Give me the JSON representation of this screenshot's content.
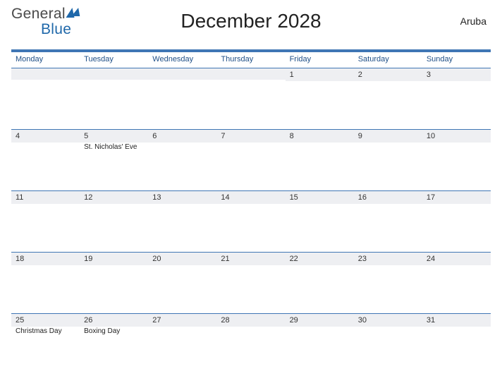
{
  "logo": {
    "part1": "General",
    "part2": "Blue"
  },
  "title": "December 2028",
  "region": "Aruba",
  "dayHeaders": [
    "Monday",
    "Tuesday",
    "Wednesday",
    "Thursday",
    "Friday",
    "Saturday",
    "Sunday"
  ],
  "weeks": [
    [
      {
        "num": "",
        "event": ""
      },
      {
        "num": "",
        "event": ""
      },
      {
        "num": "",
        "event": ""
      },
      {
        "num": "",
        "event": ""
      },
      {
        "num": "1",
        "event": ""
      },
      {
        "num": "2",
        "event": ""
      },
      {
        "num": "3",
        "event": ""
      }
    ],
    [
      {
        "num": "4",
        "event": ""
      },
      {
        "num": "5",
        "event": "St. Nicholas' Eve"
      },
      {
        "num": "6",
        "event": ""
      },
      {
        "num": "7",
        "event": ""
      },
      {
        "num": "8",
        "event": ""
      },
      {
        "num": "9",
        "event": ""
      },
      {
        "num": "10",
        "event": ""
      }
    ],
    [
      {
        "num": "11",
        "event": ""
      },
      {
        "num": "12",
        "event": ""
      },
      {
        "num": "13",
        "event": ""
      },
      {
        "num": "14",
        "event": ""
      },
      {
        "num": "15",
        "event": ""
      },
      {
        "num": "16",
        "event": ""
      },
      {
        "num": "17",
        "event": ""
      }
    ],
    [
      {
        "num": "18",
        "event": ""
      },
      {
        "num": "19",
        "event": ""
      },
      {
        "num": "20",
        "event": ""
      },
      {
        "num": "21",
        "event": ""
      },
      {
        "num": "22",
        "event": ""
      },
      {
        "num": "23",
        "event": ""
      },
      {
        "num": "24",
        "event": ""
      }
    ],
    [
      {
        "num": "25",
        "event": "Christmas Day"
      },
      {
        "num": "26",
        "event": "Boxing Day"
      },
      {
        "num": "27",
        "event": ""
      },
      {
        "num": "28",
        "event": ""
      },
      {
        "num": "29",
        "event": ""
      },
      {
        "num": "30",
        "event": ""
      },
      {
        "num": "31",
        "event": ""
      }
    ]
  ]
}
